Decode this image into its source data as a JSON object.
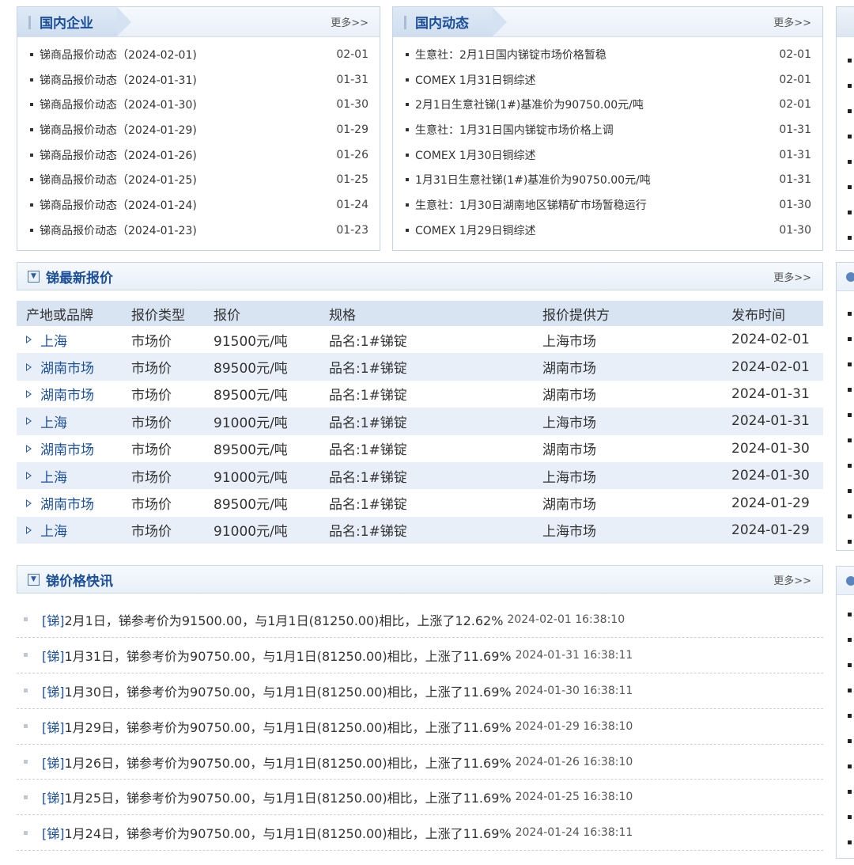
{
  "company_box": {
    "title": "国内企业",
    "more": "更多>>",
    "items": [
      {
        "title": "锑商品报价动态（2024-02-01)",
        "date": "02-01"
      },
      {
        "title": "锑商品报价动态（2024-01-31)",
        "date": "01-31"
      },
      {
        "title": "锑商品报价动态（2024-01-30)",
        "date": "01-30"
      },
      {
        "title": "锑商品报价动态（2024-01-29)",
        "date": "01-29"
      },
      {
        "title": "锑商品报价动态（2024-01-26)",
        "date": "01-26"
      },
      {
        "title": "锑商品报价动态（2024-01-25)",
        "date": "01-25"
      },
      {
        "title": "锑商品报价动态（2024-01-24)",
        "date": "01-24"
      },
      {
        "title": "锑商品报价动态（2024-01-23)",
        "date": "01-23"
      }
    ]
  },
  "domestic_box": {
    "title": "国内动态",
    "more": "更多>>",
    "items": [
      {
        "title": "生意社：2月1日国内锑锭市场价格暂稳",
        "date": "02-01"
      },
      {
        "title": "COMEX 1月31日铜综述",
        "date": "02-01"
      },
      {
        "title": "2月1日生意社锑(1#)基准价为90750.00元/吨",
        "date": "02-01"
      },
      {
        "title": "生意社：1月31日国内锑锭市场价格上调",
        "date": "01-31"
      },
      {
        "title": "COMEX 1月30日铜综述",
        "date": "01-31"
      },
      {
        "title": "1月31日生意社锑(1#)基准价为90750.00元/吨",
        "date": "01-31"
      },
      {
        "title": "生意社：1月30日湖南地区锑精矿市场暂稳运行",
        "date": "01-30"
      },
      {
        "title": "COMEX 1月29日铜综述",
        "date": "01-30"
      }
    ]
  },
  "price_section": {
    "title": "锑最新报价",
    "more": "更多>>",
    "columns": [
      "产地或品牌",
      "报价类型",
      "报价",
      "规格",
      "报价提供方",
      "发布时间"
    ],
    "rows": [
      {
        "origin": "上海",
        "type": "市场价",
        "price": "91500元/吨",
        "spec": "品名:1#锑锭",
        "provider": "上海市场",
        "date": "2024-02-01"
      },
      {
        "origin": "湖南市场",
        "type": "市场价",
        "price": "89500元/吨",
        "spec": "品名:1#锑锭",
        "provider": "湖南市场",
        "date": "2024-02-01"
      },
      {
        "origin": "湖南市场",
        "type": "市场价",
        "price": "89500元/吨",
        "spec": "品名:1#锑锭",
        "provider": "湖南市场",
        "date": "2024-01-31"
      },
      {
        "origin": "上海",
        "type": "市场价",
        "price": "91000元/吨",
        "spec": "品名:1#锑锭",
        "provider": "上海市场",
        "date": "2024-01-31"
      },
      {
        "origin": "湖南市场",
        "type": "市场价",
        "price": "89500元/吨",
        "spec": "品名:1#锑锭",
        "provider": "湖南市场",
        "date": "2024-01-30"
      },
      {
        "origin": "上海",
        "type": "市场价",
        "price": "91000元/吨",
        "spec": "品名:1#锑锭",
        "provider": "上海市场",
        "date": "2024-01-30"
      },
      {
        "origin": "湖南市场",
        "type": "市场价",
        "price": "89500元/吨",
        "spec": "品名:1#锑锭",
        "provider": "湖南市场",
        "date": "2024-01-29"
      },
      {
        "origin": "上海",
        "type": "市场价",
        "price": "91000元/吨",
        "spec": "品名:1#锑锭",
        "provider": "上海市场",
        "date": "2024-01-29"
      }
    ]
  },
  "flash_section": {
    "title": "锑价格快讯",
    "more": "更多>>",
    "items": [
      {
        "tag": "[锑]",
        "text": "2月1日，锑参考价为91500.00，与1月1日(81250.00)相比，上涨了12.62%",
        "time": "2024-02-01 16:38:10"
      },
      {
        "tag": "[锑]",
        "text": "1月31日，锑参考价为90750.00，与1月1日(81250.00)相比，上涨了11.69%",
        "time": "2024-01-31 16:38:11"
      },
      {
        "tag": "[锑]",
        "text": "1月30日，锑参考价为90750.00，与1月1日(81250.00)相比，上涨了11.69%",
        "time": "2024-01-30 16:38:11"
      },
      {
        "tag": "[锑]",
        "text": "1月29日，锑参考价为90750.00，与1月1日(81250.00)相比，上涨了11.69%",
        "time": "2024-01-29 16:38:10"
      },
      {
        "tag": "[锑]",
        "text": "1月26日，锑参考价为90750.00，与1月1日(81250.00)相比，上涨了11.69%",
        "time": "2024-01-26 16:38:10"
      },
      {
        "tag": "[锑]",
        "text": "1月25日，锑参考价为90750.00，与1月1日(81250.00)相比，上涨了11.69%",
        "time": "2024-01-25 16:38:10"
      },
      {
        "tag": "[锑]",
        "text": "1月24日，锑参考价为90750.00，与1月1日(81250.00)相比，上涨了11.69%",
        "time": "2024-01-24 16:38:11"
      }
    ]
  },
  "icons": {
    "section_icon": "download-box-icon",
    "row_marker": "triangle-right-icon",
    "right_header": "circle-arrow-icon"
  },
  "colors": {
    "accent": "#1c4f9a",
    "table_header_bg": "#d9e4f3",
    "row_alt_bg": "#e8eff9",
    "border": "#c5d5e6"
  }
}
